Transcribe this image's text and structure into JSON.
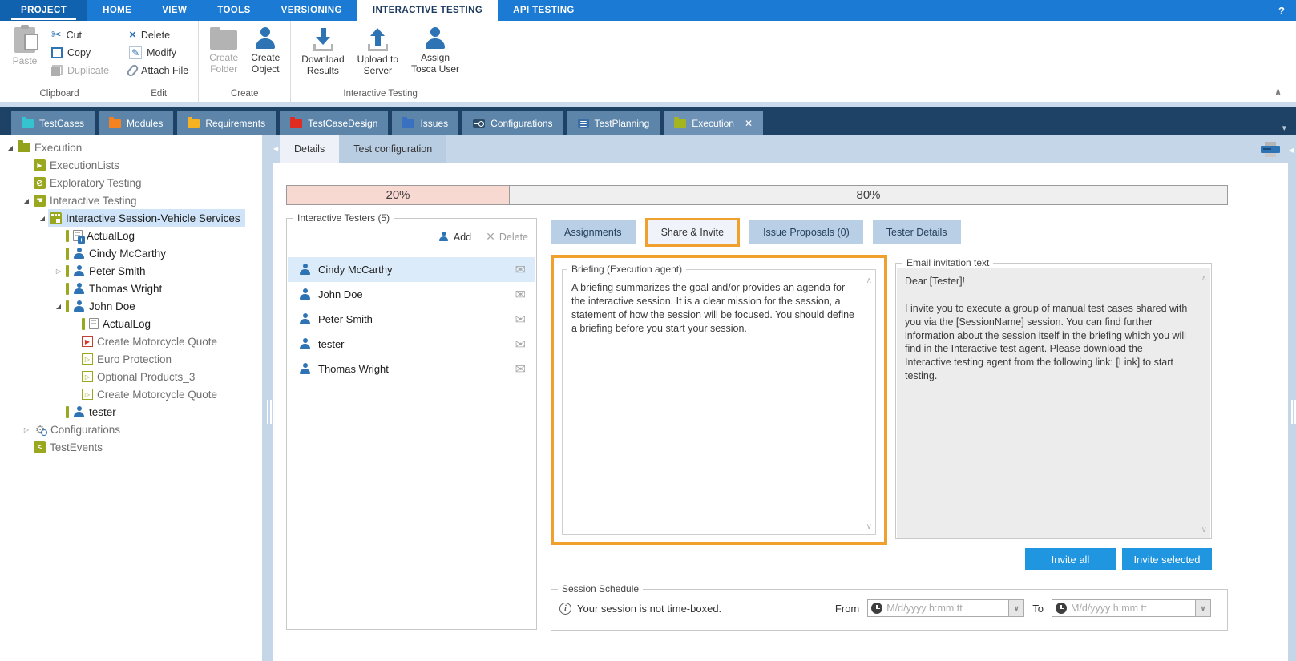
{
  "menubar": {
    "items": [
      {
        "label": "PROJECT"
      },
      {
        "label": "HOME"
      },
      {
        "label": "VIEW"
      },
      {
        "label": "TOOLS"
      },
      {
        "label": "VERSIONING"
      },
      {
        "label": "INTERACTIVE TESTING"
      },
      {
        "label": "API TESTING"
      }
    ],
    "help": "?"
  },
  "ribbon": {
    "clipboard": {
      "label": "Clipboard",
      "paste": "Paste",
      "cut": "Cut",
      "copy": "Copy",
      "duplicate": "Duplicate"
    },
    "edit": {
      "label": "Edit",
      "delete": "Delete",
      "modify": "Modify",
      "attach": "Attach File"
    },
    "create": {
      "label": "Create",
      "create_folder": "Create\nFolder",
      "create_object": "Create\nObject"
    },
    "interactive": {
      "label": "Interactive Testing",
      "download": "Download\nResults",
      "upload": "Upload to\nServer",
      "assign": "Assign\nTosca User"
    }
  },
  "icons": {
    "tab_close": "✕",
    "tabbar_caret": "▾",
    "ribbon_collapse": "∧",
    "cut": "✂",
    "modify": "✎",
    "delete_x": "×",
    "envelope": "✉",
    "edge_arrow": "◀",
    "scroll_up": "∧",
    "scroll_down": "∨",
    "dd_caret": "∨",
    "info_i": "i"
  },
  "tabbar": {
    "tabs": [
      {
        "label": "TestCases",
        "icon": "folder-cyan"
      },
      {
        "label": "Modules",
        "icon": "folder-orange"
      },
      {
        "label": "Requirements",
        "icon": "folder-amber"
      },
      {
        "label": "TestCaseDesign",
        "icon": "folder-red"
      },
      {
        "label": "Issues",
        "icon": "folder-blue"
      },
      {
        "label": "Configurations",
        "icon": "config-chip"
      },
      {
        "label": "TestPlanning",
        "icon": "planning-chip"
      },
      {
        "label": "Execution",
        "icon": "folder-olive",
        "cls": "active",
        "closable": true
      }
    ]
  },
  "tree": {
    "items": [
      {
        "label": "Execution",
        "level": 0,
        "icon": "t-folder",
        "arrow": "exp",
        "cls": "muted"
      },
      {
        "label": "ExecutionLists",
        "level": 1,
        "icon": "t-sq t-execlists",
        "cls": "muted"
      },
      {
        "label": "Exploratory Testing",
        "level": 1,
        "icon": "t-sq t-exploratory",
        "cls": "muted"
      },
      {
        "label": "Interactive Testing",
        "level": 1,
        "icon": "t-sq t-interactive",
        "arrow": "exp",
        "cls": "muted"
      },
      {
        "label": "Interactive Session-Vehicle Services",
        "level": 2,
        "icon": "t-sq t-session",
        "arrow": "exp",
        "cls": "sel"
      },
      {
        "label": "ActualLog",
        "level": 3,
        "icon": "t-page t-logplus",
        "bar": true
      },
      {
        "label": "Cindy McCarthy",
        "level": 3,
        "icon": "t-user",
        "bar": true
      },
      {
        "label": "Peter Smith",
        "level": 3,
        "icon": "t-user",
        "bar": true,
        "arrow": "col"
      },
      {
        "label": "Thomas Wright",
        "level": 3,
        "icon": "t-user",
        "bar": true
      },
      {
        "label": "John Doe",
        "level": 3,
        "icon": "t-user",
        "bar": true,
        "arrow": "exp"
      },
      {
        "label": "ActualLog",
        "level": 4,
        "icon": "t-page",
        "bar": true
      },
      {
        "label": "Create Motorcycle Quote",
        "level": 4,
        "icon": "t-playred",
        "cls": "muted"
      },
      {
        "label": "Euro Protection",
        "level": 4,
        "icon": "t-playolive",
        "cls": "muted"
      },
      {
        "label": "Optional Products_3",
        "level": 4,
        "icon": "t-playolive",
        "cls": "muted"
      },
      {
        "label": "Create Motorcycle Quote",
        "level": 4,
        "icon": "t-playolive",
        "cls": "muted"
      },
      {
        "label": "tester",
        "level": 3,
        "icon": "t-user",
        "bar": true
      },
      {
        "label": "Configurations",
        "level": 1,
        "icon": "t-config",
        "arrow": "col",
        "cls": "muted"
      },
      {
        "label": "TestEvents",
        "level": 1,
        "icon": "t-sq t-events",
        "cls": "muted"
      }
    ]
  },
  "main": {
    "doc_tabs": {
      "details": "Details",
      "test_configuration": "Test configuration"
    },
    "progress": {
      "left_label": "20%",
      "right_label": "80%"
    }
  },
  "testers": {
    "title": "Interactive Testers (5)",
    "add": "Add",
    "delete": "Delete",
    "list": [
      {
        "name": "Cindy McCarthy",
        "cls": "sel"
      },
      {
        "name": "John Doe"
      },
      {
        "name": "Peter Smith"
      },
      {
        "name": "tester"
      },
      {
        "name": "Thomas Wright"
      }
    ]
  },
  "share": {
    "tabs": [
      {
        "label": "Assignments"
      },
      {
        "label": "Share & Invite"
      },
      {
        "label": "Issue Proposals (0)"
      },
      {
        "label": "Tester Details"
      }
    ],
    "briefing": {
      "title": "Briefing (Execution agent)",
      "text": "A briefing summarizes the goal and/or provides an agenda for the interactive session. It is a clear mission for the session, a statement of how the session will be focused. You should define a briefing before you start your session."
    },
    "email": {
      "title": "Email invitation text",
      "text": "Dear [Tester]!\n\nI invite you to execute a group of manual test cases shared with you via the [SessionName] session. You can find further information about the session itself in the briefing which you will find in the Interactive test agent. Please download the Interactive testing agent from the following link: [Link] to start testing."
    },
    "invite_all": "Invite all",
    "invite_selected": "Invite selected"
  },
  "schedule": {
    "title": "Session Schedule",
    "info": "Your session is not time-boxed.",
    "from_label": "From",
    "to_label": "To",
    "from_placeholder": "M/d/yyyy h:mm tt",
    "to_placeholder": "M/d/yyyy h:mm tt"
  },
  "colors": {
    "accent_blue": "#1b7ad3",
    "navy": "#1e4166",
    "highlight_orange": "#efa02d",
    "button_blue": "#2095e0",
    "olive": "#9aa81f",
    "progress_pink": "#f8d9d2"
  }
}
